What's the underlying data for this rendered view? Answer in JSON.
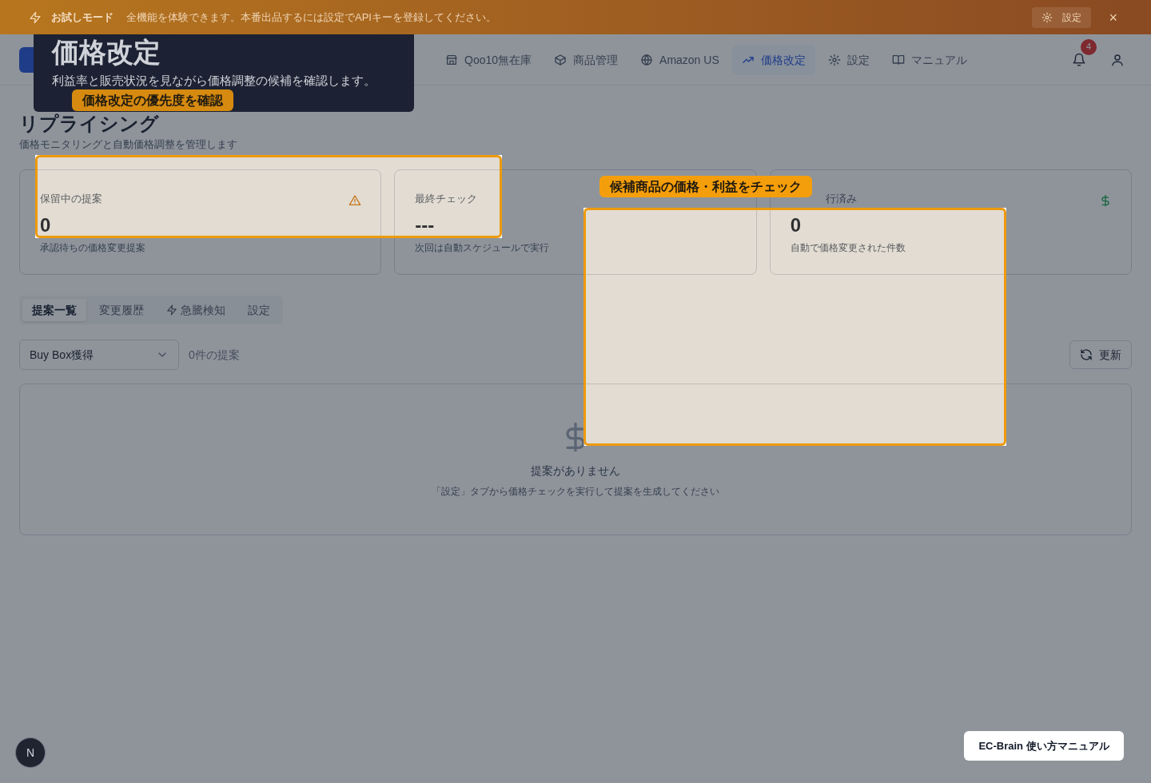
{
  "banner": {
    "title": "お試しモード",
    "message": "全機能を体験できます。本番出品するには設定でAPIキーを登録してください。",
    "settings_button": "設定",
    "close": "×"
  },
  "nav": {
    "items": [
      {
        "label": "Qoo10無在庫",
        "selected": false
      },
      {
        "label": "商品管理",
        "selected": false
      },
      {
        "label": "Amazon US",
        "selected": false
      },
      {
        "label": "価格改定",
        "selected": true
      },
      {
        "label": "設定",
        "selected": false
      },
      {
        "label": "マニュアル",
        "selected": false
      }
    ],
    "notification_count": "4"
  },
  "page": {
    "title": "リプライシング",
    "subtitle": "価格モニタリングと自動価格調整を管理します"
  },
  "stats": [
    {
      "title": "保留中の提案",
      "value": "0",
      "note": "承認待ちの価格変更提案"
    },
    {
      "title": "最終チェック",
      "value": "---",
      "note": "次回は自動スケジュールで実行"
    },
    {
      "title": "行済み",
      "value": "0",
      "note": "自動で価格変更された件数"
    }
  ],
  "tabs": [
    {
      "label": "提案一覧",
      "selected": true
    },
    {
      "label": "変更履歴",
      "selected": false
    },
    {
      "label": "急騰検知",
      "selected": false
    },
    {
      "label": "設定",
      "selected": false
    }
  ],
  "filter": {
    "select": "Buy Box獲得",
    "count": "0件の提案",
    "refresh": "更新"
  },
  "empty": {
    "title": "提案がありません",
    "message": "「設定」タブから価格チェックを実行して提案を生成してください"
  },
  "tour": {
    "tooltip": {
      "title": "価格改定",
      "description": "利益率と販売状況を見ながら価格調整の候補を確認します。"
    },
    "highlights": [
      {
        "label": "価格改定の優先度を確認"
      },
      {
        "label": "候補商品の価格・利益をチェック"
      }
    ]
  },
  "dev_badge": "N",
  "manual_button": "EC-Brain 使い方マニュアル"
}
